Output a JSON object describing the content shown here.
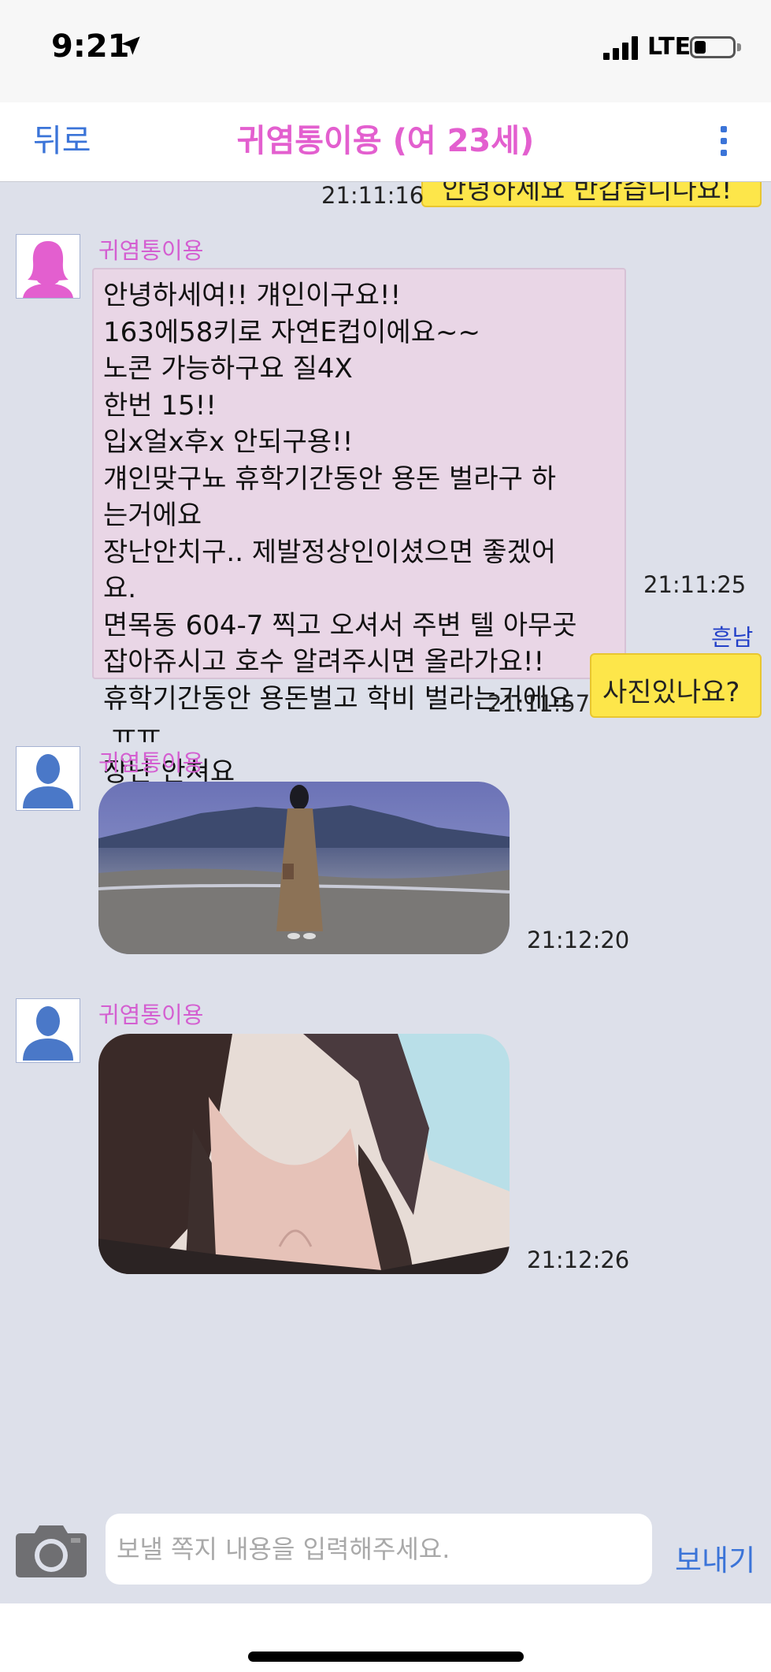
{
  "status_bar": {
    "time": "9:21",
    "network": "LTE",
    "battery_level": 0.2
  },
  "nav": {
    "back_label": "뒤로",
    "title": "귀염통이용 (여 23세)"
  },
  "messages": [
    {
      "type": "out",
      "partial_text": "안녕하세요 반갑습니다요!",
      "time": "21:11:16"
    },
    {
      "type": "in",
      "sender": "귀염통이용",
      "avatar_color": "#e35fcf",
      "lines": [
        "안녕하세여!! 걔인이구요!!",
        "163에58키로 자연E컵이에요~~",
        "노콘 가능하구요 질4X",
        "한번 15!!",
        "입x얼x후x 안되구용!!",
        "걔인맞구뇨 휴학기간동안 용돈 벌라구 하",
        "는거에요",
        "장난안치구.. 제발정상인이셨으면 좋겠어",
        "요.",
        "면목동 604-7 찍고 오셔서 주변 텔 아무곳",
        "잡아쥬시고 호수 알려주시면 올라가요!!",
        "휴학기간동안 용돈벌고 학비 벌라는거에요",
        " ㅠㅠ",
        "장난 안쳐요"
      ],
      "time": "21:11:25"
    },
    {
      "type": "out",
      "sender": "흔남",
      "text": "사진있나요?",
      "time": "21:11:57"
    },
    {
      "type": "in_photo",
      "sender": "귀염통이용",
      "avatar_color": "#4a78c8",
      "time": "21:12:20"
    },
    {
      "type": "in_photo",
      "sender": "귀염통이용",
      "avatar_color": "#4a78c8",
      "time": "21:12:26"
    }
  ],
  "input_bar": {
    "placeholder": "보낼 쪽지 내용을 입력해주세요.",
    "send_label": "보내기"
  },
  "colors": {
    "accent_blue": "#3b74d8",
    "title_pink": "#e35fcf",
    "chat_bg": "#dde0ea",
    "bubble_out": "#fde64a",
    "bubble_in": "#e9d6e6"
  }
}
